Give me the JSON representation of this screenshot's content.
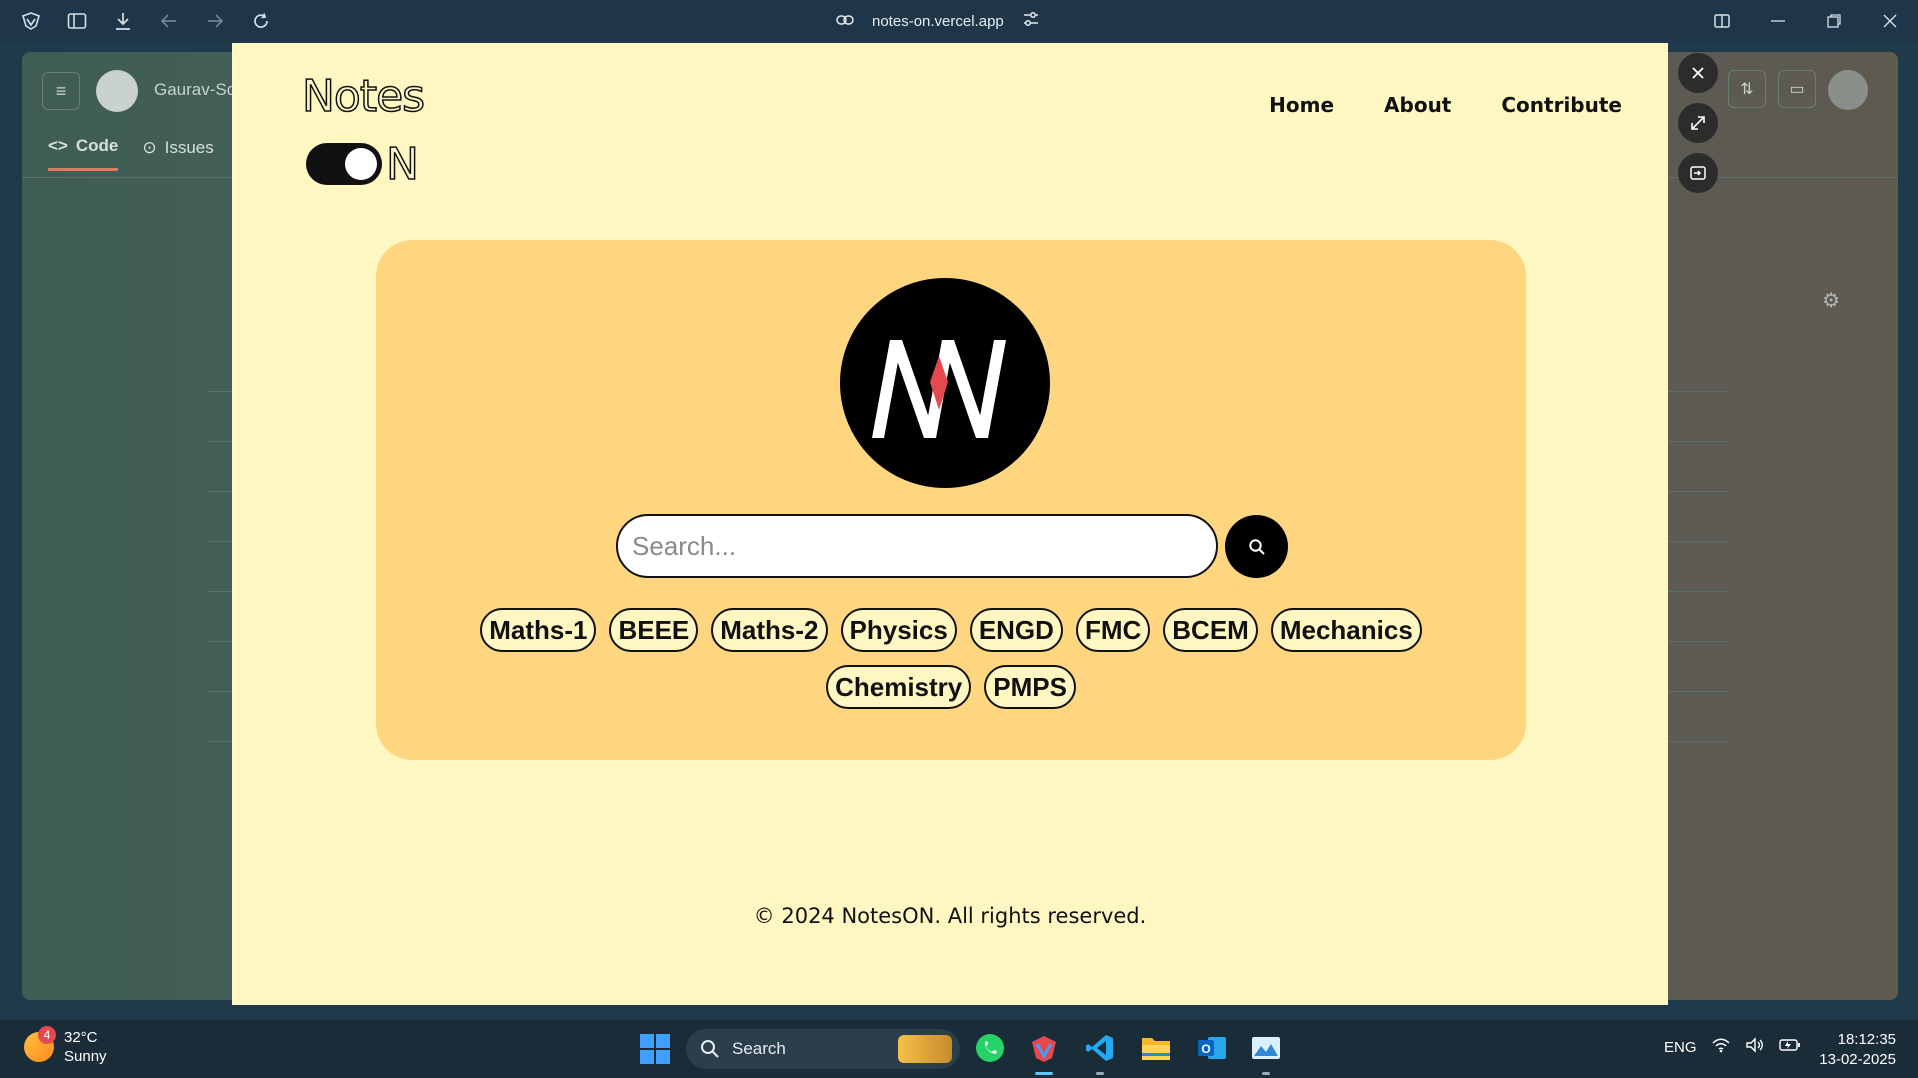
{
  "browser": {
    "url": "notes-on.vercel.app"
  },
  "background_page": {
    "user": "Gaurav-Sc",
    "tabs": [
      {
        "label": "Code"
      },
      {
        "label": "Issues"
      }
    ]
  },
  "app": {
    "logo": {
      "word1": "Notes",
      "word2": "N"
    },
    "nav": [
      {
        "label": "Home"
      },
      {
        "label": "About"
      },
      {
        "label": "Contribute"
      }
    ],
    "search": {
      "placeholder": "Search..."
    },
    "subjects": [
      "Maths-1",
      "BEEE",
      "Maths-2",
      "Physics",
      "ENGD",
      "FMC",
      "BCEM",
      "Mechanics",
      "Chemistry",
      "PMPS"
    ],
    "footer": "© 2024 NotesON. All rights reserved.",
    "colors": {
      "page_bg": "#fff7c2",
      "hero_bg": "#ffd680",
      "accent": "#e5484d"
    }
  },
  "taskbar": {
    "weather": {
      "temp": "32°C",
      "condition": "Sunny",
      "badge": "4"
    },
    "search_label": "Search",
    "apps": [
      "whatsapp-icon",
      "browser-icon",
      "vscode-icon",
      "file-explorer-icon",
      "outlook-icon",
      "photos-icon"
    ],
    "lang": "ENG",
    "time": "18:12:35",
    "date": "13-02-2025"
  }
}
